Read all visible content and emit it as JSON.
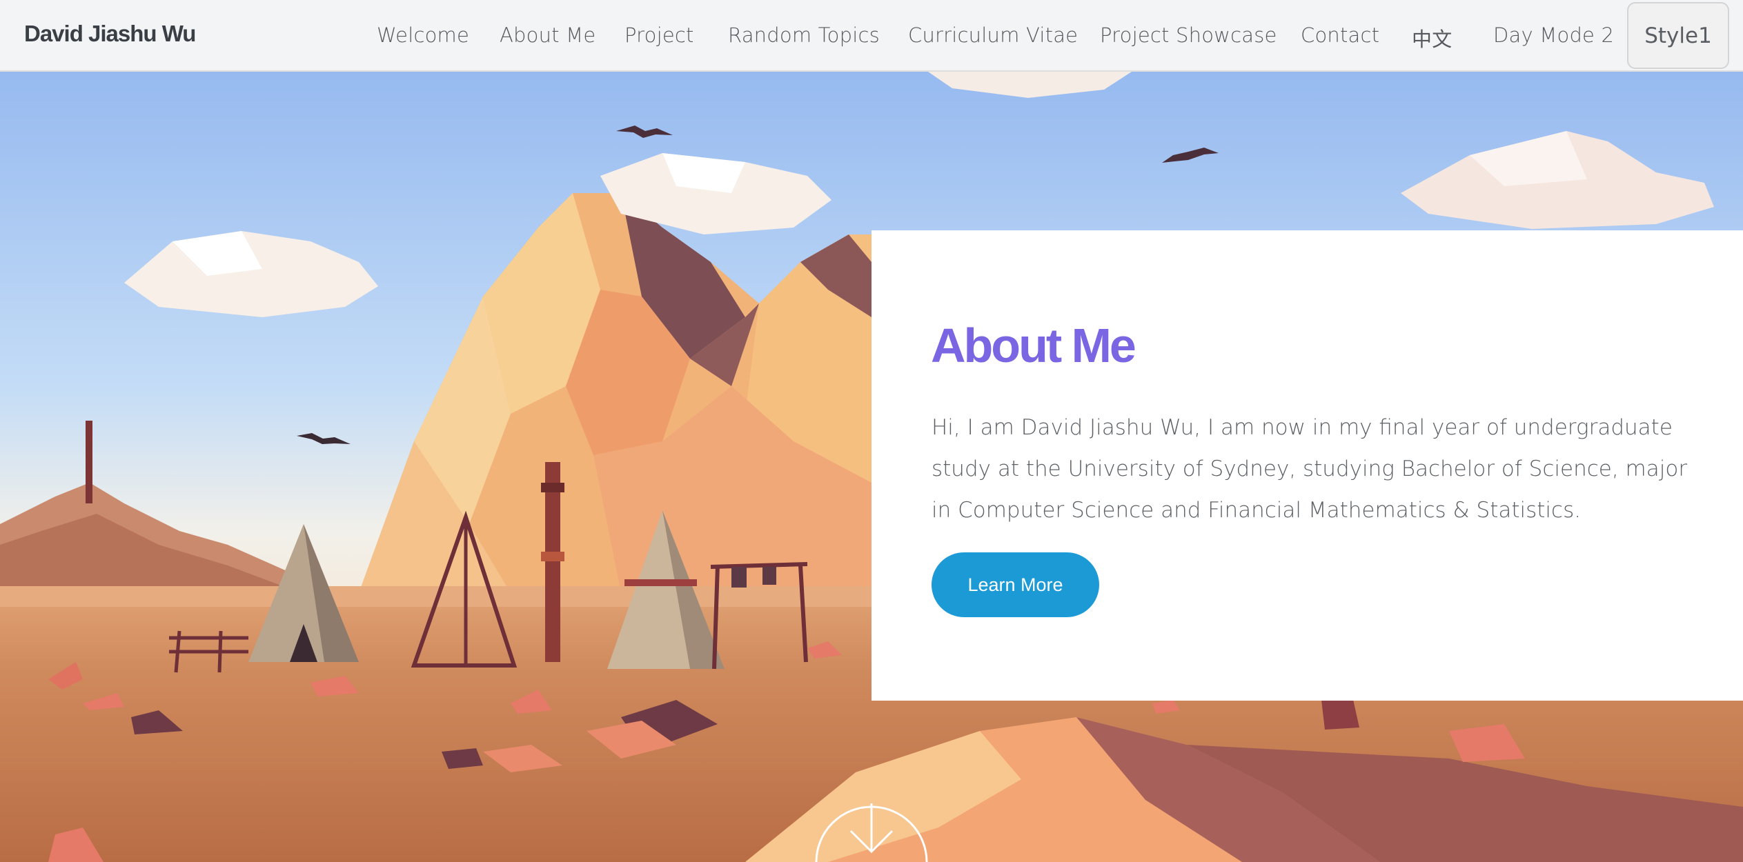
{
  "brand": {
    "name": "David Jiashu Wu"
  },
  "nav": {
    "items": [
      {
        "label": "Welcome"
      },
      {
        "label": "About Me"
      },
      {
        "label": "Project"
      },
      {
        "label": "Random Topics"
      },
      {
        "label": "Curriculum Vitae"
      },
      {
        "label": "Project Showcase"
      },
      {
        "label": "Contact"
      },
      {
        "label": "中文"
      },
      {
        "label": "Day Mode 2"
      }
    ],
    "style_button": "Style1"
  },
  "about": {
    "title": "About Me",
    "text": "Hi, I am David Jiashu Wu, I am now in my final year of undergraduate study at the University of Sydney, studying Bachelor of Science, major in Computer Science and Financial Mathematics & Statistics.",
    "button_label": "Learn More"
  },
  "icons": {
    "scroll": "chevron-down-icon"
  },
  "colors": {
    "title_accent": "#7a66e3",
    "button": "#1b9ad6",
    "nav_bg": "#f6f6f6",
    "sky_top": "#8fb4ee",
    "ground": "#c77a52"
  }
}
